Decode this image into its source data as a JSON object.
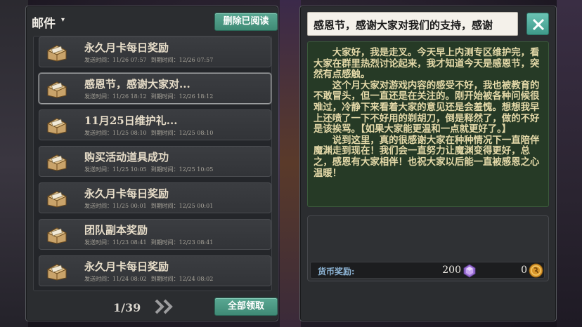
{
  "mail_panel": {
    "title": "邮件",
    "delete_read_label": "删除已阅读",
    "claim_all_label": "全部领取",
    "pagination": "1/39",
    "items": [
      {
        "subject": "永久月卡每日奖励",
        "sent": "发送时间：11/26 07:57",
        "expire": "到期时间：12/26 07:57",
        "icon": "mail-package-icon"
      },
      {
        "subject": "感恩节，感谢大家对...",
        "sent": "发送时间：11/26 18:12",
        "expire": "到期时间：12/26 18:12",
        "icon": "mail-package-icon"
      },
      {
        "subject": "11月25日维护礼...",
        "sent": "发送时间：11/25 08:10",
        "expire": "到期时间：12/25 08:10",
        "icon": "mail-package-icon"
      },
      {
        "subject": "购买活动道具成功",
        "sent": "发送时间：11/25 10:05",
        "expire": "到期时间：12/25 10:05",
        "icon": "mail-package-icon"
      },
      {
        "subject": "永久月卡每日奖励",
        "sent": "发送时间：11/25 00:01",
        "expire": "到期时间：12/25 00:01",
        "icon": "mail-package-icon"
      },
      {
        "subject": "团队副本奖励",
        "sent": "发送时间：11/23 08:41",
        "expire": "到期时间：12/23 08:41",
        "icon": "mail-package-icon"
      },
      {
        "subject": "永久月卡每日奖励",
        "sent": "发送时间：11/24 08:02",
        "expire": "到期时间：12/24 08:02",
        "icon": "mail-package-icon"
      }
    ],
    "selected_index": 1
  },
  "mail_detail": {
    "title": "感恩节，感谢大家对我们的支持，感谢",
    "paragraphs": [
      "大家好，我是走叉。今天早上内测专区维护完，看大家在群里热烈讨论起来，我才知道今天是感恩节，突然有点感触。",
      "这个月大家对游戏内容的感受不好，我也被教育的不敢冒头，但一直还是在关注的。刚开始被各种问候很难过，冷静下来看着大家的意见还是会羞愧。想想我早上还喷了一下不好用的剃胡刀，倒是释然了，做的不好是该挨骂。【如果大家能更温和一点就更好了。】",
      "说到这里，真的很感谢大家在种种情况下一直陪伴魔渊走到现在！我们会一直努力让魔渊变得更好，总之，感恩有大家相伴！也祝大家以后能一直被感恩之心温暖！"
    ],
    "reward_label": "货币奖励:",
    "gem_amount": "200",
    "gold_amount": "0"
  },
  "colors": {
    "button_green": "#4f9c86",
    "body_bg": "#263a26",
    "body_text": "#e4d9a8",
    "subject_text": "#e6dcc8"
  }
}
